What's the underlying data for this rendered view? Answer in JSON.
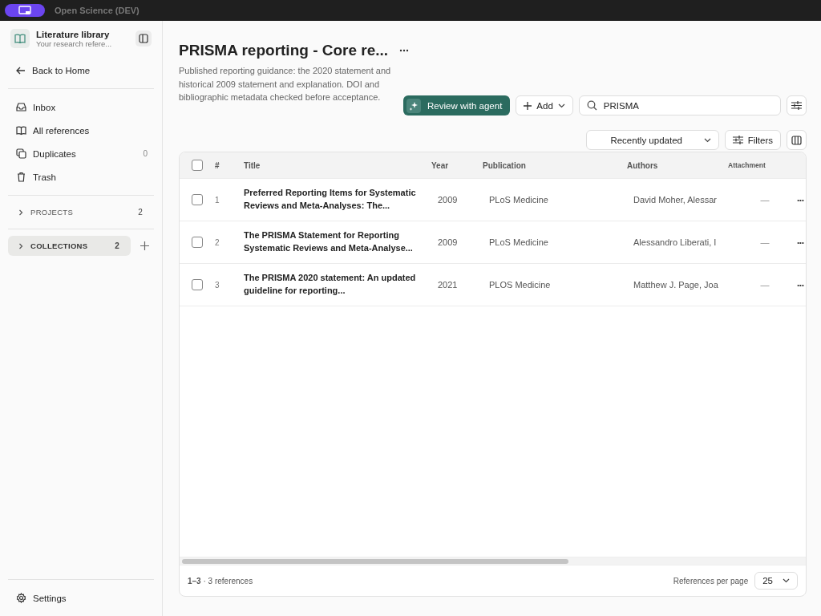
{
  "topbar": {
    "workspace": "Open Science (DEV)"
  },
  "sidebar": {
    "library": {
      "title": "Literature library",
      "subtitle": "Your research refere..."
    },
    "back": "Back to Home",
    "nav": [
      {
        "kind": "inbox",
        "label": "Inbox",
        "selected": false
      },
      {
        "kind": "all",
        "label": "All references",
        "selected": false
      },
      {
        "kind": "duplicates",
        "label": "Duplicates",
        "count": "0",
        "selected": false
      },
      {
        "kind": "trash",
        "label": "Trash",
        "selected": false
      }
    ],
    "sections": [
      {
        "label": "PROJECTS",
        "count": "2",
        "selected": false,
        "expanded": false,
        "addable": false
      },
      {
        "label": "COLLECTIONS",
        "count": "2",
        "selected": true,
        "expanded": false,
        "addable": true
      }
    ],
    "settings": "Settings"
  },
  "header": {
    "title": "PRISMA reporting - Core re...",
    "description": "Published reporting guidance: the 2020 statement and historical 2009 statement and explanation. DOI and bibliographic metadata checked before acceptance."
  },
  "toolbar": {
    "review": "Review with agent",
    "add": "Add",
    "search": "PRISMA",
    "sort": "Recently updated",
    "filters": "Filters"
  },
  "table": {
    "columns": [
      "#",
      "Title",
      "Year",
      "Publication",
      "Authors",
      "Attachment"
    ],
    "header_checked": false,
    "rows": [
      {
        "checked": false,
        "number": "1",
        "title": "Preferred Reporting Items for Systematic Reviews and Meta-Analyses: The...",
        "year": "2009",
        "publication": "PLoS Medicine",
        "authors": "David Moher, Alessar",
        "attachment": "—",
        "actions": "•••"
      },
      {
        "checked": false,
        "number": "2",
        "title": "The PRISMA Statement for Reporting Systematic Reviews and Meta-Analyse...",
        "year": "2009",
        "publication": "PLoS Medicine",
        "authors": "Alessandro Liberati, I",
        "attachment": "—",
        "actions": "•••"
      },
      {
        "checked": false,
        "number": "3",
        "title": "The PRISMA 2020 statement: An updated guideline for reporting...",
        "year": "2021",
        "publication": "PLOS Medicine",
        "authors": "Matthew J. Page, Joa",
        "attachment": "—",
        "actions": "•••"
      }
    ]
  },
  "footer": {
    "summary": "**1–3** · 3 references",
    "per_page_label": "References per page",
    "per_page": "25"
  }
}
